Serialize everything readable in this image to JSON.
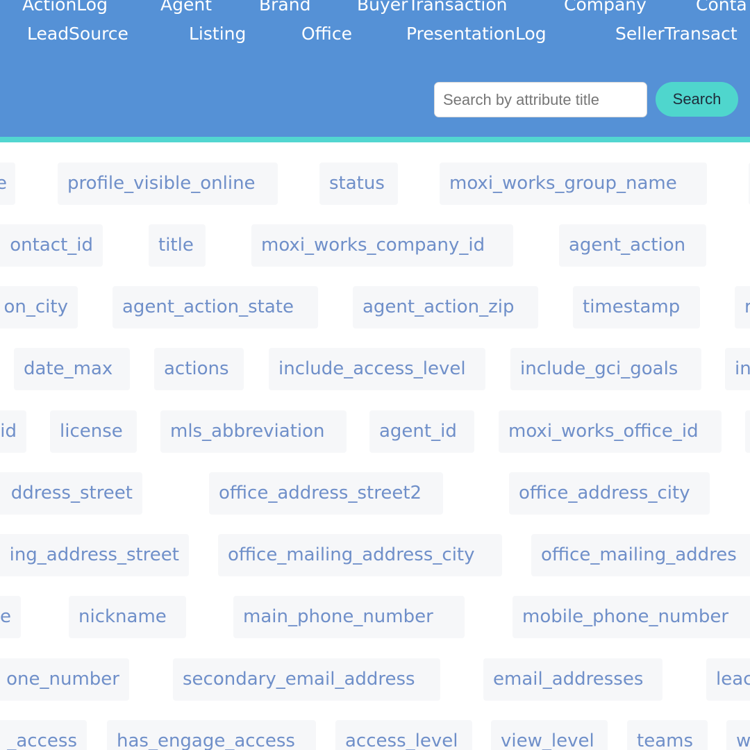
{
  "nav": {
    "row1": [
      "ActionLog",
      "Agent",
      "Brand",
      "BuyerTransaction",
      "Company",
      "Conta"
    ],
    "row2": [
      "LeadSource",
      "Listing",
      "Office",
      "PresentationLog",
      "SellerTransact"
    ]
  },
  "search": {
    "placeholder": "Search by attribute title",
    "value": "",
    "button_label": "Search"
  },
  "attribute_rows": [
    [
      "e",
      "profile_visible_online",
      "status",
      "moxi_works_group_name",
      ""
    ],
    [
      "ontact_id",
      "title",
      "moxi_works_company_id",
      "agent_action"
    ],
    [
      "on_city",
      "agent_action_state",
      "agent_action_zip",
      "timestamp",
      "r"
    ],
    [
      "date_max",
      "actions",
      "include_access_level",
      "include_gci_goals",
      "in"
    ],
    [
      "id",
      "license",
      "mls_abbreviation",
      "agent_id",
      "moxi_works_office_id",
      ""
    ],
    [
      "ddress_street",
      "office_address_street2",
      "office_address_city"
    ],
    [
      "ing_address_street",
      "office_mailing_address_city",
      "office_mailing_addres"
    ],
    [
      "e",
      "nickname",
      "main_phone_number",
      "mobile_phone_number"
    ],
    [
      "one_number",
      "secondary_email_address",
      "email_addresses",
      "leac"
    ],
    [
      "_access",
      "has_engage_access",
      "access_level",
      "view_level",
      "teams",
      "w"
    ]
  ],
  "colors": {
    "header_bg": "#5591d6",
    "accent": "#52d6d0",
    "search_button_bg": "#4fd6cd",
    "tag_bg": "#f6f7f9",
    "tag_text": "#6f8fc9"
  }
}
